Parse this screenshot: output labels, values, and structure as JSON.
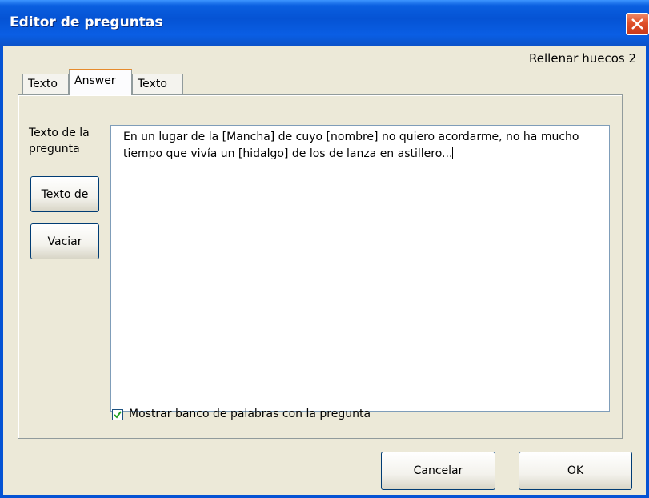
{
  "window": {
    "title": "Editor de preguntas"
  },
  "header": {
    "question_type": "Rellenar huecos 2"
  },
  "tabs": [
    {
      "label": "Texto"
    },
    {
      "label": "Answer"
    },
    {
      "label": "Texto"
    }
  ],
  "editor": {
    "label": "Texto de la pregunta",
    "text_button": "Texto de",
    "clear_button": "Vaciar",
    "question_text": "En un lugar de la [Mancha] de cuyo [nombre] no quiero acordarme, no ha mucho tiempo que vivía un [hidalgo] de los de lanza en astillero..."
  },
  "options": {
    "show_word_bank_label": "Mostrar banco de palabras con la pregunta",
    "show_word_bank_checked": true
  },
  "footer": {
    "cancel_label": "Cancelar",
    "ok_label": "OK"
  },
  "colors": {
    "titlebar": "#0553d4",
    "close": "#e0502a",
    "dialog_bg": "#ece9d8",
    "active_tab_accent": "#e68b2c"
  }
}
